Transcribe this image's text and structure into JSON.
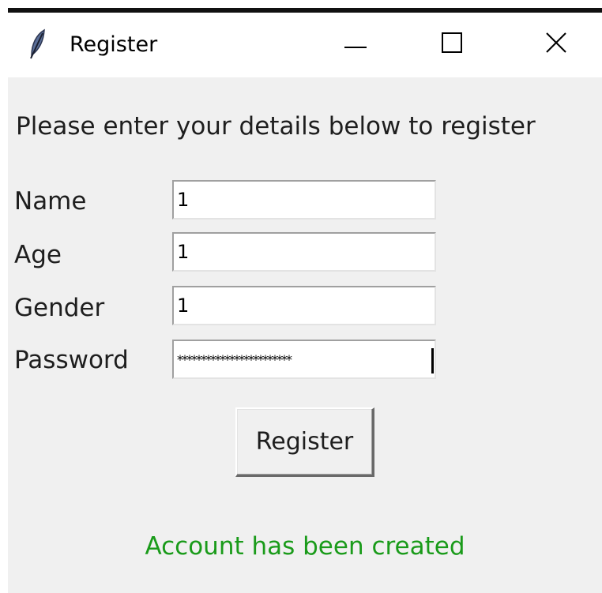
{
  "window": {
    "title": "Register",
    "icon": "feather-icon"
  },
  "form": {
    "heading": "Please enter your details below to register",
    "fields": [
      {
        "label": "Name",
        "value": "1"
      },
      {
        "label": "Age",
        "value": "1"
      },
      {
        "label": "Gender",
        "value": "1"
      },
      {
        "label": "Password",
        "value": "************************"
      }
    ],
    "submit_label": "Register"
  },
  "status": {
    "message": "Account has been created",
    "color": "#1a9b1a"
  },
  "colors": {
    "client_background": "#f0f0f0",
    "titlebar_background": "#ffffff"
  }
}
